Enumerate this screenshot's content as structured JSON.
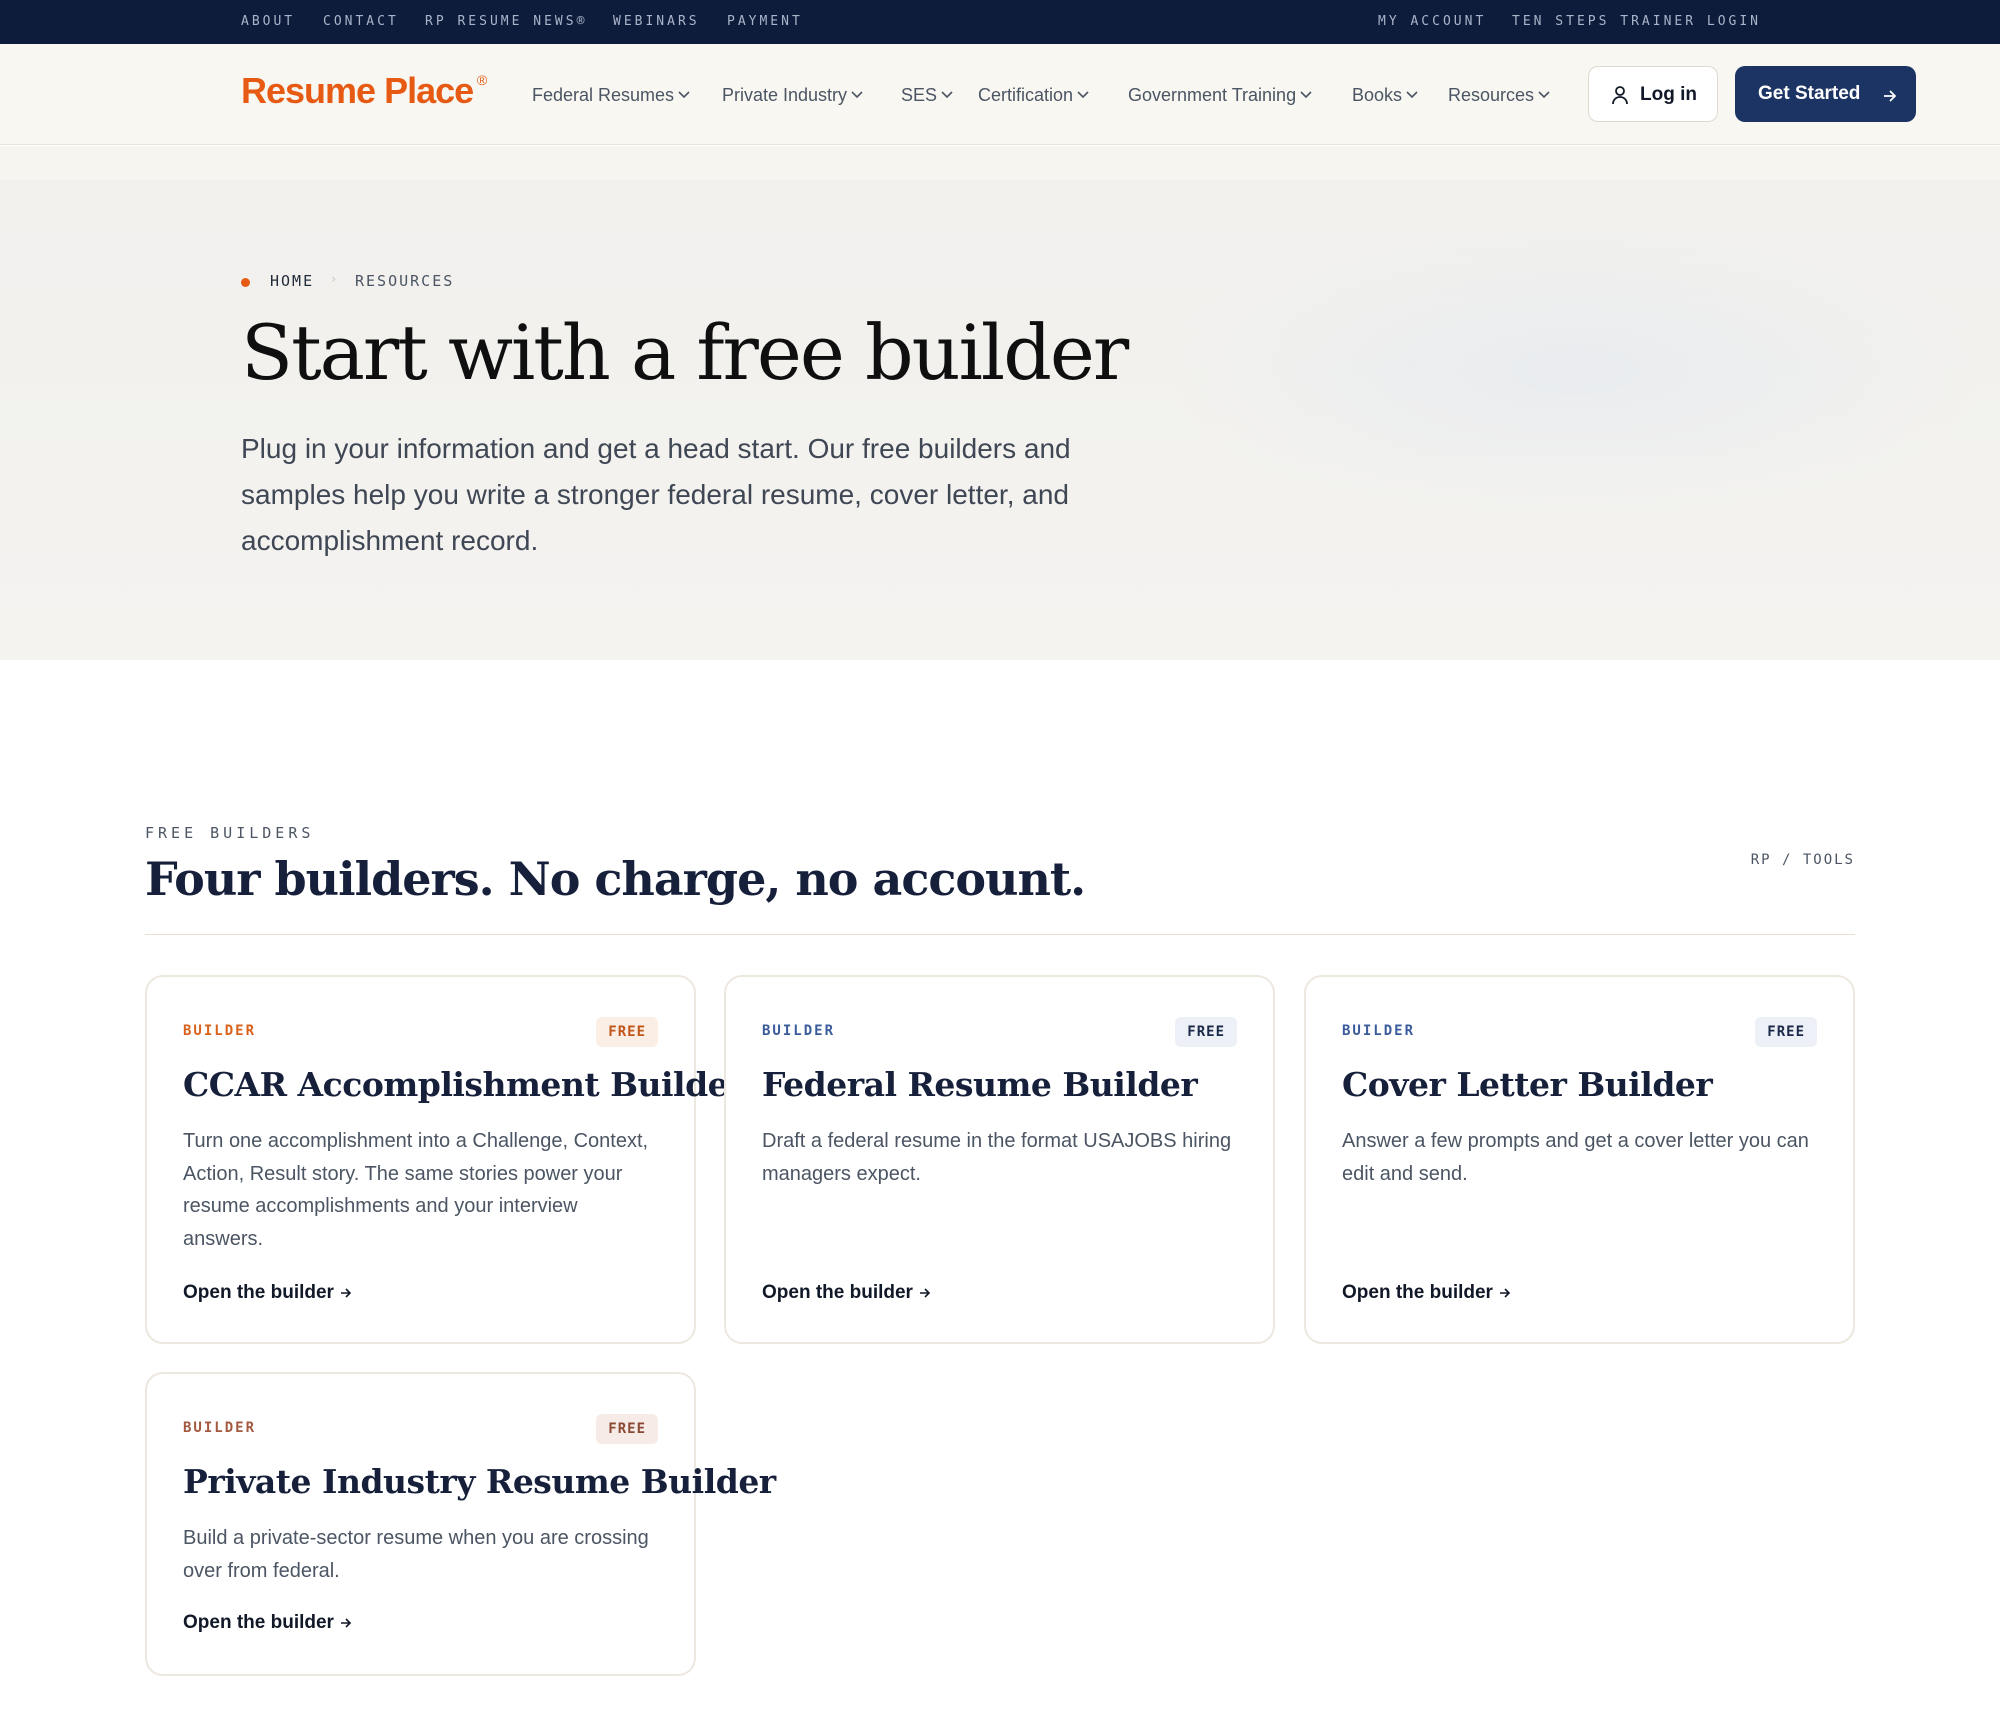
{
  "utility_nav": {
    "left": [
      "ABOUT",
      "CONTACT",
      "RP RESUME NEWS®",
      "WEBINARS",
      "PAYMENT"
    ],
    "right": [
      "MY ACCOUNT",
      "TEN STEPS TRAINER LOGIN"
    ]
  },
  "header": {
    "brand": "Resume Place",
    "brand_mark": "®",
    "nav": [
      "Federal Resumes",
      "Private Industry",
      "SES",
      "Certification",
      "Government Training",
      "Books",
      "Resources"
    ],
    "login_label": "Log in",
    "cta_label": "Get Started"
  },
  "hero": {
    "breadcrumb_home": "HOME",
    "breadcrumb_sep": "›",
    "breadcrumb_current": "RESOURCES",
    "title": "Start with a free builder",
    "description": "Plug in your information and get a head start. Our free builders and samples help you write a stronger federal resume, cover letter, and accomplishment record."
  },
  "section": {
    "eyebrow": "FREE BUILDERS",
    "title": "Four builders. No charge, no account.",
    "tag": "RP / TOOLS"
  },
  "cards": [
    {
      "eyebrow": "BUILDER",
      "badge": "FREE",
      "title": "CCAR Accomplishment Builder",
      "description": "Turn one accomplishment into a Challenge, Context, Action, Result story. The same stories power your resume accomplishments and your interview answers.",
      "cta": "Open the builder",
      "accent": "#d9621c",
      "badge_bg": "#fbeee4",
      "badge_fg": "#c0561a"
    },
    {
      "eyebrow": "BUILDER",
      "badge": "FREE",
      "title": "Federal Resume Builder",
      "description": "Draft a federal resume in the format USAJOBS hiring managers expect.",
      "cta": "Open the builder",
      "accent": "#3b5c9c",
      "badge_bg": "#edf0f6",
      "badge_fg": "#1b2a4a"
    },
    {
      "eyebrow": "BUILDER",
      "badge": "FREE",
      "title": "Cover Letter Builder",
      "description": "Answer a few prompts and get a cover letter you can edit and send.",
      "cta": "Open the builder",
      "accent": "#3b5c9c",
      "badge_bg": "#edf0f6",
      "badge_fg": "#1b2a4a"
    },
    {
      "eyebrow": "BUILDER",
      "badge": "FREE",
      "title": "Private Industry Resume Builder",
      "description": "Build a private-sector resume when you are crossing over from federal.",
      "cta": "Open the builder",
      "accent": "#a35a40",
      "badge_bg": "#f6ebe6",
      "badge_fg": "#8a4a34"
    }
  ]
}
